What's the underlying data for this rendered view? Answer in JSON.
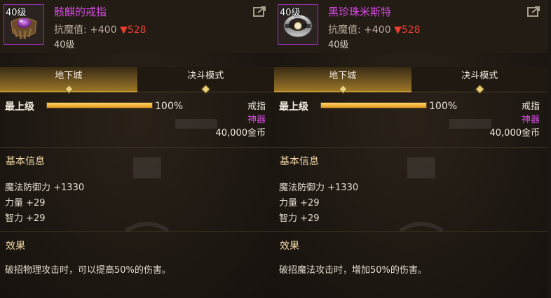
{
  "panels": [
    {
      "item": {
        "level_badge": "40级",
        "name": "骸麒的戒指",
        "stat_label": "抗魔值:",
        "stat_plus": "+400",
        "stat_down": "▼528",
        "level_text": "40级"
      },
      "tabs": [
        {
          "label": "地下城",
          "active": true
        },
        {
          "label": "决斗模式",
          "active": false
        }
      ],
      "upgrade": {
        "label": "最上级",
        "progress_pct": 100,
        "percent_text": "100%"
      },
      "meta": {
        "type": "戒指",
        "rarity": "神器",
        "price": "40,000金币"
      },
      "basic": {
        "title": "基本信息",
        "attrs": [
          "魔法防御力 +1330",
          "力量 +29",
          "智力 +29"
        ]
      },
      "effect": {
        "title": "效果",
        "text": "破招物理攻击时，可以提高50%的伤害。"
      }
    },
    {
      "item": {
        "level_badge": "40级",
        "name": "黑珍珠米斯特",
        "stat_label": "抗魔值:",
        "stat_plus": "+400",
        "stat_down": "▼528",
        "level_text": "40级"
      },
      "tabs": [
        {
          "label": "地下城",
          "active": true
        },
        {
          "label": "决斗模式",
          "active": false
        }
      ],
      "upgrade": {
        "label": "最上级",
        "progress_pct": 100,
        "percent_text": "100%"
      },
      "meta": {
        "type": "戒指",
        "rarity": "神器",
        "price": "40,000金币"
      },
      "basic": {
        "title": "基本信息",
        "attrs": [
          "魔法防御力 +1330",
          "力量 +29",
          "智力 +29"
        ]
      },
      "effect": {
        "title": "效果",
        "text": "破招魔法攻击时，增加50%的伤害。"
      }
    }
  ],
  "colors": {
    "rarity": "#d44be0",
    "accent_gold": "#c59a35",
    "down_red": "#e84030"
  },
  "icons": [
    "share-icon",
    "ring-icon"
  ]
}
